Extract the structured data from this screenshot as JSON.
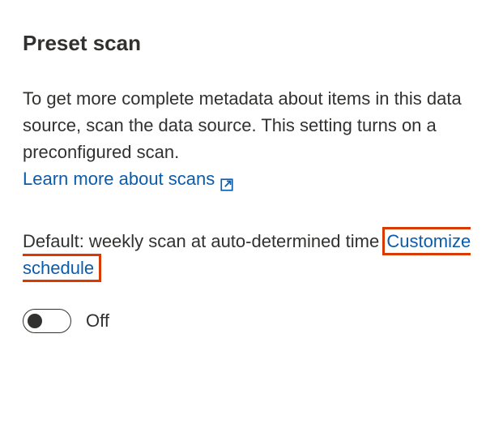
{
  "section": {
    "title": "Preset scan",
    "description": "To get more complete metadata about items in this data source, scan the data source. This setting turns on a preconfigured scan.",
    "learn_more_label": "Learn more about scans",
    "default_prefix": "Default: weekly scan at auto-determined time ",
    "customize_label": "Customize schedule",
    "toggle": {
      "state": "off",
      "label": "Off"
    }
  }
}
